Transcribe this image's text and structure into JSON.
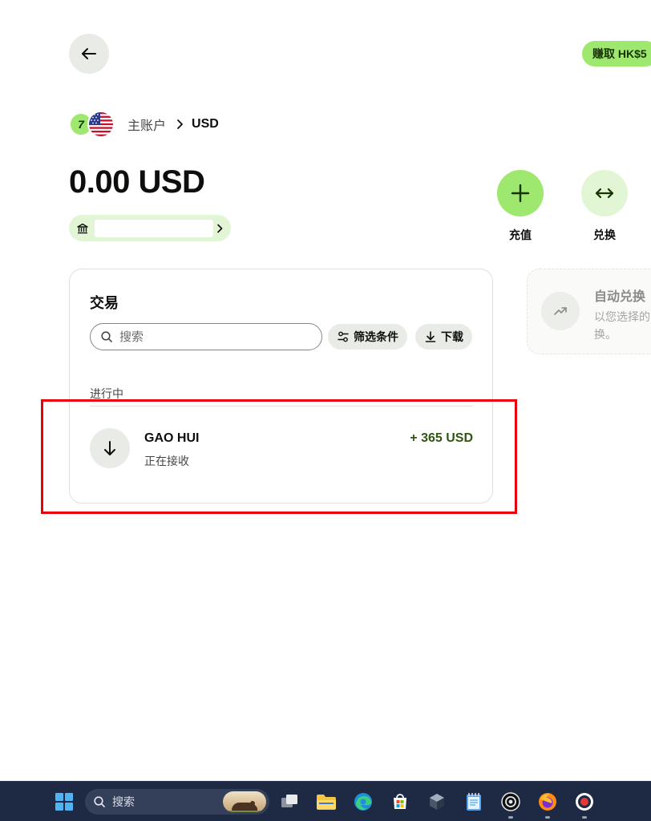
{
  "header": {
    "earn_badge": "赚取 HK$5"
  },
  "breadcrumb": {
    "logo_text": "7",
    "account": "主账户",
    "current": "USD"
  },
  "balance": {
    "amount": "0.00 USD"
  },
  "actions": {
    "topup_label": "充值",
    "convert_label": "兑换"
  },
  "transactions": {
    "title": "交易",
    "search_placeholder": "搜索",
    "filter_label": "筛选条件",
    "download_label": "下载",
    "section_in_progress": "进行中",
    "items": [
      {
        "name": "GAO HUI",
        "status": "正在接收",
        "amount": "+ 365 USD"
      }
    ]
  },
  "auto_convert": {
    "title": "自动兑换",
    "description": "以您选择的 换。"
  },
  "taskbar": {
    "search_placeholder": "搜索"
  },
  "colors": {
    "brand_green": "#9fe870",
    "light_green": "#e2f6d5",
    "positive_amount": "#2f5711",
    "highlight_red": "#e8000b",
    "taskbar_bg": "#1e2a44"
  }
}
